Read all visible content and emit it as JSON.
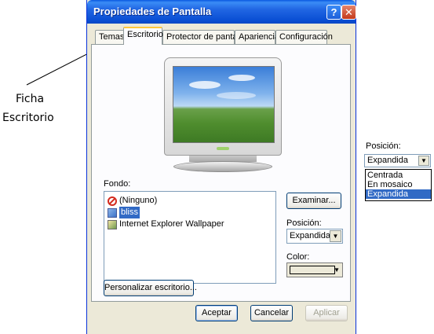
{
  "window": {
    "title": "Propiedades de Pantalla",
    "help_glyph": "?",
    "close_glyph": "✕"
  },
  "tabs": [
    {
      "label": "Temas",
      "active": false
    },
    {
      "label": "Escritorio",
      "active": true
    },
    {
      "label": "Protector de pantalla",
      "active": false
    },
    {
      "label": "Apariencia",
      "active": false
    },
    {
      "label": "Configuración",
      "active": false
    }
  ],
  "desktop": {
    "background_label": "Fondo:",
    "background_items": [
      {
        "label": "(Ninguno)",
        "icon": "no-symbol-icon",
        "selected": false
      },
      {
        "label": "bliss",
        "icon": "bitmap-file-icon",
        "selected": true
      },
      {
        "label": "Internet Explorer Wallpaper",
        "icon": "ie-wallpaper-icon",
        "selected": false
      }
    ],
    "browse_button": "Examinar...",
    "position_label": "Posición:",
    "position_value": "Expandida",
    "color_label": "Color:",
    "customize_button": "Personalizar escritorio..."
  },
  "footer": {
    "ok": "Aceptar",
    "cancel": "Cancelar",
    "apply": "Aplicar"
  },
  "annotations": {
    "tab_callout_line1": "Ficha",
    "tab_callout_line2": "Escritorio"
  },
  "position_popup": {
    "label": "Posición:",
    "value": "Expandida",
    "options": [
      {
        "label": "Centrada",
        "selected": false
      },
      {
        "label": "En mosaico",
        "selected": false
      },
      {
        "label": "Expandida",
        "selected": true
      }
    ]
  },
  "colors": {
    "titlebar": "#0a4fd4",
    "selection": "#316ac5",
    "dialog_bg": "#ece9d8"
  }
}
